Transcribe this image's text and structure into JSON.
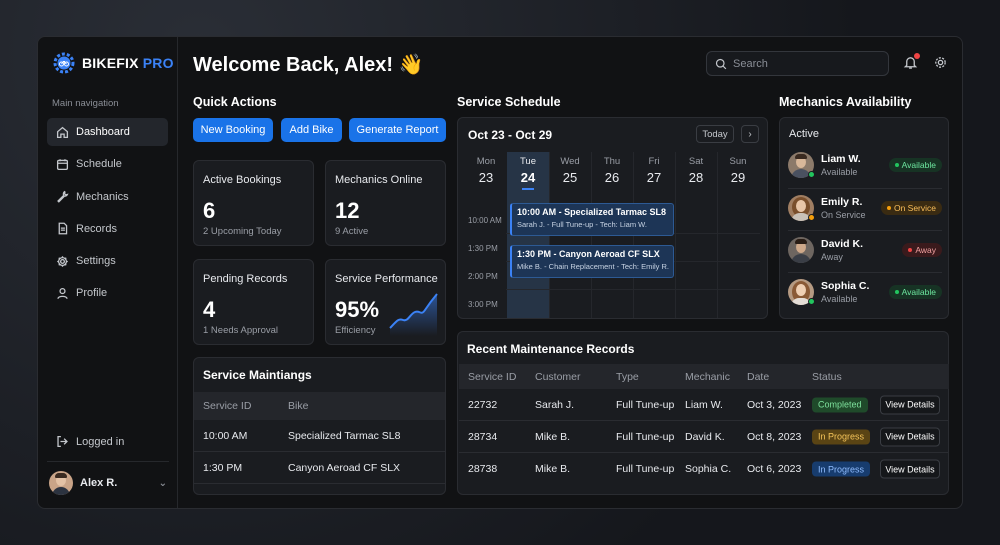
{
  "brand": {
    "name": "BIKEFIX",
    "suffix": "PRO",
    "accent": "#3b82f6"
  },
  "sidebar": {
    "heading": "Main navigation",
    "items": [
      {
        "label": "Dashboard",
        "icon": "home-icon",
        "active": true
      },
      {
        "label": "Schedule",
        "icon": "calendar-icon"
      },
      {
        "label": "Mechanics",
        "icon": "wrench-icon"
      },
      {
        "label": "Records",
        "icon": "document-icon"
      },
      {
        "label": "Settings",
        "icon": "gear-icon"
      },
      {
        "label": "Profile",
        "icon": "user-icon"
      }
    ],
    "logged_in": "Logged in",
    "user": "Alex R."
  },
  "header": {
    "welcome": "Welcome Back, Alex! 👋",
    "search_placeholder": "Search"
  },
  "quick_actions": {
    "title": "Quick Actions",
    "buttons": [
      "New Booking",
      "Add Bike",
      "Generate Report"
    ]
  },
  "stats": {
    "active_bookings": {
      "label": "Active Bookings",
      "value": "6",
      "sub": "2 Upcoming Today"
    },
    "mechanics_online": {
      "label": "Mechanics Online",
      "value": "12",
      "sub": "9 Active"
    },
    "pending_records": {
      "label": "Pending Records",
      "value": "4",
      "sub": "1 Needs Approval"
    },
    "service_performance": {
      "label": "Service Performance",
      "value": "95%",
      "sub": "Efficiency"
    }
  },
  "service_maintainings": {
    "title": "Service Maintiangs",
    "columns": [
      "Service ID",
      "Bike"
    ],
    "rows": [
      {
        "id": "10:00 AM",
        "bike": "Specialized Tarmac SL8"
      },
      {
        "id": "1:30 PM",
        "bike": "Canyon Aeroad CF SLX"
      }
    ]
  },
  "schedule": {
    "title": "Service Schedule",
    "range": "Oct 23 - Oct 29",
    "today": "Today",
    "next": "›",
    "days": [
      {
        "name": "Mon",
        "date": "23"
      },
      {
        "name": "Tue",
        "date": "24",
        "selected": true
      },
      {
        "name": "Wed",
        "date": "25"
      },
      {
        "name": "Thu",
        "date": "26"
      },
      {
        "name": "Fri",
        "date": "27"
      },
      {
        "name": "Sat",
        "date": "28"
      },
      {
        "name": "Sun",
        "date": "29"
      }
    ],
    "times": [
      "10:00 AM",
      "1:30 PM",
      "2:00 PM",
      "3:00 PM"
    ],
    "events": [
      {
        "title": "10:00 AM - Specialized Tarmac SL8",
        "detail": "Sarah J. - Full Tune-up - Tech: Liam W."
      },
      {
        "title": "1:30 PM - Canyon Aeroad CF SLX",
        "detail": "Mike B. - Chain Replacement - Tech: Emily R."
      }
    ]
  },
  "mechanics": {
    "title": "Mechanics Availability",
    "subtitle": "Active",
    "list": [
      {
        "name": "Liam W.",
        "sub": "Available",
        "status": "Available",
        "color": "#22c55e",
        "bg": "#173324",
        "fg": "#6ee7a0"
      },
      {
        "name": "Emily R.",
        "sub": "On Service",
        "status": "On Service",
        "color": "#f59e0b",
        "bg": "#3a2b12",
        "fg": "#fbbf5a"
      },
      {
        "name": "David K.",
        "sub": "Away",
        "status": "Away",
        "color": "#ef4444",
        "bg": "#3a1a1c",
        "fg": "#f2a0a0"
      },
      {
        "name": "Sophia C.",
        "sub": "Available",
        "status": "Available",
        "color": "#22c55e",
        "bg": "#173324",
        "fg": "#6ee7a0"
      }
    ]
  },
  "records": {
    "title": "Recent Maintenance Records",
    "columns": [
      "Service ID",
      "Customer",
      "Type",
      "Mechanic",
      "Date",
      "Status"
    ],
    "rows": [
      {
        "id": "22732",
        "customer": "Sarah J.",
        "type": "Full Tune-up",
        "mechanic": "Liam W.",
        "date": "Oct 3, 2023",
        "status": "Completed",
        "bg": "#1f4a2a",
        "fg": "#7ee29d",
        "action": "View Details"
      },
      {
        "id": "28734",
        "customer": "Mike B.",
        "type": "Full Tune-up",
        "mechanic": "David K.",
        "date": "Oct 8, 2023",
        "status": "In Progress",
        "bg": "#5a4414",
        "fg": "#f5c45a",
        "action": "View Details"
      },
      {
        "id": "28738",
        "customer": "Mike B.",
        "type": "Full Tune-up",
        "mechanic": "Sophia C.",
        "date": "Oct 6, 2023",
        "status": "In Progress",
        "bg": "#173c6e",
        "fg": "#8fbcff",
        "action": "View Details"
      }
    ]
  }
}
